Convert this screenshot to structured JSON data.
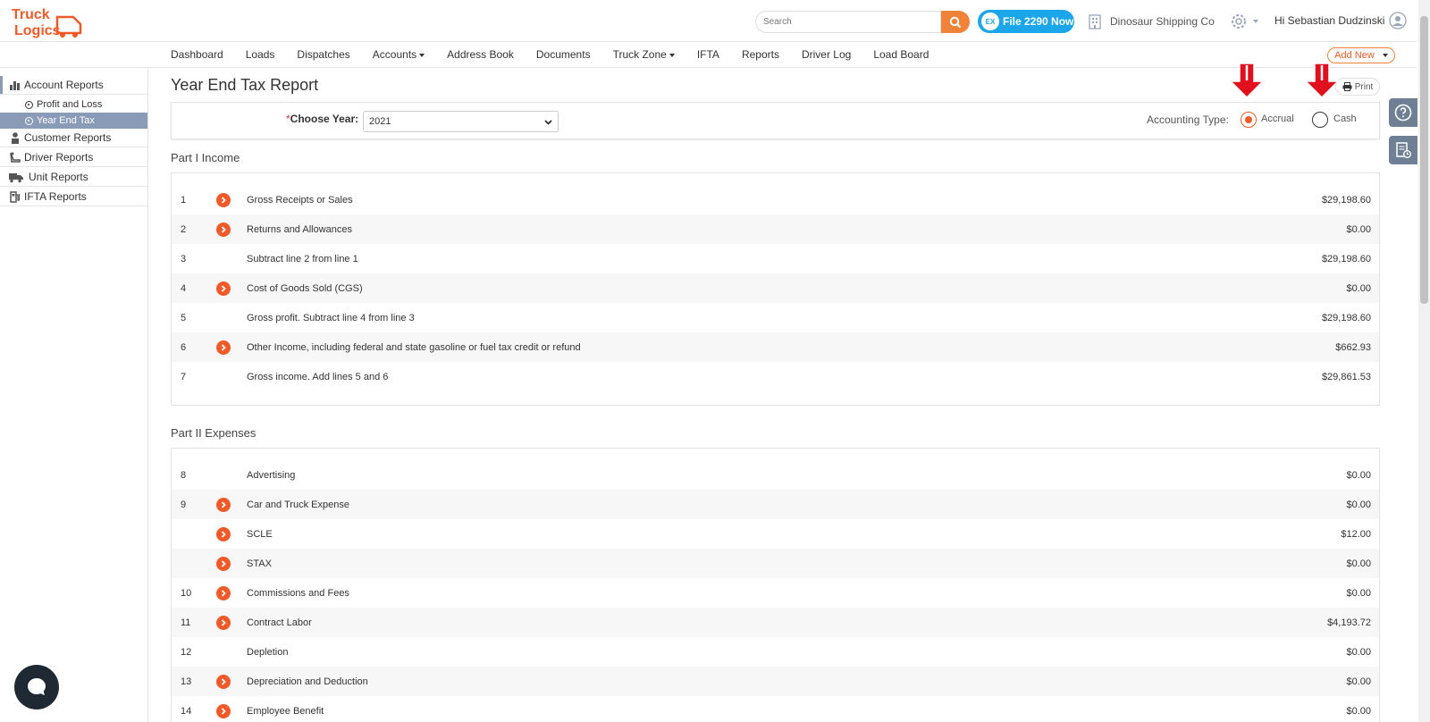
{
  "brand": {
    "logo_line1": "Truck",
    "logo_line2": "Logics",
    "accent": "#f05a28"
  },
  "header": {
    "search_placeholder": "Search",
    "file_button": "File 2290 Now",
    "file_icon_text": "EX",
    "company": "Dinosaur Shipping Co",
    "greeting": "Hi Sebastian Dudzinski"
  },
  "nav": {
    "items": [
      "Dashboard",
      "Loads",
      "Dispatches",
      "Accounts",
      "Address Book",
      "Documents",
      "Truck Zone",
      "IFTA",
      "Reports",
      "Driver Log",
      "Load Board"
    ],
    "add_new": "Add New"
  },
  "sidebar": {
    "account_reports": "Account Reports",
    "profit_and_loss": "Profit and Loss",
    "year_end_tax": "Year End Tax",
    "customer_reports": "Customer Reports",
    "driver_reports": "Driver Reports",
    "unit_reports": "Unit Reports",
    "ifta_reports": "IFTA Reports"
  },
  "page": {
    "title": "Year End Tax Report",
    "print": "Print",
    "choose_year_label": "Choose Year:",
    "required_mark": "*",
    "year_value": "2021",
    "accounting_type_label": "Accounting Type:",
    "accrual": "Accrual",
    "cash": "Cash",
    "accounting_type_selected": "Accrual"
  },
  "part1": {
    "title": "Part I Income",
    "rows": [
      {
        "num": "1",
        "arrow": true,
        "desc": "Gross Receipts or Sales",
        "amount": "$29,198.60"
      },
      {
        "num": "2",
        "arrow": true,
        "desc": "Returns and Allowances",
        "amount": "$0.00"
      },
      {
        "num": "3",
        "arrow": false,
        "desc": "Subtract line 2 from line 1",
        "amount": "$29,198.60"
      },
      {
        "num": "4",
        "arrow": true,
        "desc": "Cost of Goods Sold (CGS)",
        "amount": "$0.00"
      },
      {
        "num": "5",
        "arrow": false,
        "desc": "Gross profit. Subtract line 4 from line 3",
        "amount": "$29,198.60"
      },
      {
        "num": "6",
        "arrow": true,
        "desc": "Other Income, including federal and state gasoline or fuel tax credit or refund",
        "amount": "$662.93"
      },
      {
        "num": "7",
        "arrow": false,
        "desc": "Gross income. Add lines 5 and 6",
        "amount": "$29,861.53"
      }
    ]
  },
  "part2": {
    "title": "Part II Expenses",
    "rows": [
      {
        "num": "8",
        "arrow": false,
        "desc": "Advertising",
        "amount": "$0.00"
      },
      {
        "num": "9",
        "arrow": true,
        "desc": "Car and Truck Expense",
        "amount": "$0.00"
      },
      {
        "num": "",
        "arrow": true,
        "desc": "SCLE",
        "amount": "$12.00"
      },
      {
        "num": "",
        "arrow": true,
        "desc": "STAX",
        "amount": "$0.00"
      },
      {
        "num": "10",
        "arrow": true,
        "desc": "Commissions and Fees",
        "amount": "$0.00"
      },
      {
        "num": "11",
        "arrow": true,
        "desc": "Contract Labor",
        "amount": "$4,193.72"
      },
      {
        "num": "12",
        "arrow": false,
        "desc": "Depletion",
        "amount": "$0.00"
      },
      {
        "num": "13",
        "arrow": true,
        "desc": "Depreciation and Deduction",
        "amount": "$0.00"
      },
      {
        "num": "14",
        "arrow": true,
        "desc": "Employee Benefit",
        "amount": "$0.00"
      }
    ]
  }
}
